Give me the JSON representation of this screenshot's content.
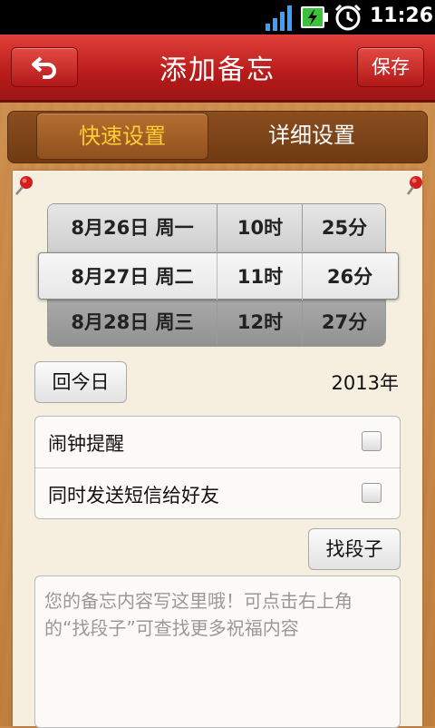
{
  "status_bar": {
    "time": "11:26"
  },
  "title_bar": {
    "title": "添加备忘",
    "save_label": "保存"
  },
  "tabs": [
    {
      "label": "快速设置",
      "selected": true
    },
    {
      "label": "详细设置",
      "selected": false
    }
  ],
  "date_picker": {
    "rows": [
      {
        "date": "8月26日 周一",
        "hour": "10时",
        "minute": "25分"
      },
      {
        "date": "8月27日 周二",
        "hour": "11时",
        "minute": "26分"
      },
      {
        "date": "8月28日 周三",
        "hour": "12时",
        "minute": "27分"
      }
    ]
  },
  "today_button": "回今日",
  "year": "2013年",
  "settings": [
    {
      "label": "闹钟提醒",
      "checked": false
    },
    {
      "label": "同时发送短信给好友",
      "checked": false
    }
  ],
  "find_button": "找段子",
  "memo": {
    "placeholder": "您的备忘内容写这里哦！可点击右上角的“找段子”可查找更多祝福内容"
  },
  "colors": {
    "title_bar": "#c0231f",
    "tab_selected_text": "#ffcc33",
    "paper": "#f6efe0"
  }
}
